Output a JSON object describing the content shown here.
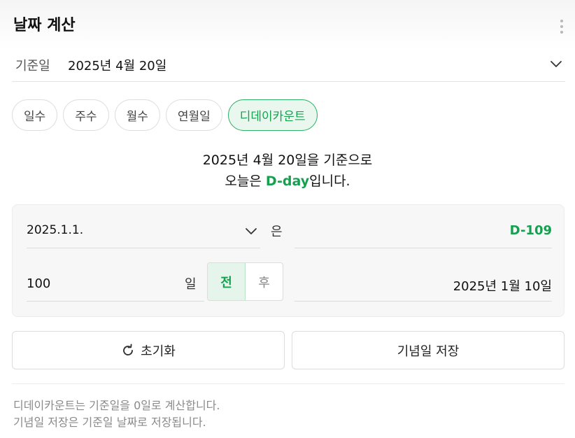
{
  "header": {
    "title": "날짜 계산",
    "more_icon": "more-vertical-icon"
  },
  "base_date": {
    "label": "기준일",
    "value": "2025년 4월 20일"
  },
  "tabs": [
    {
      "label": "일수",
      "active": false
    },
    {
      "label": "주수",
      "active": false
    },
    {
      "label": "월수",
      "active": false
    },
    {
      "label": "연월일",
      "active": false
    },
    {
      "label": "디데이카운트",
      "active": true
    }
  ],
  "result": {
    "line1": "2025년 4월 20일을 기준으로",
    "line2_prefix": "오늘은 ",
    "line2_highlight": "D-day",
    "line2_suffix": "입니다."
  },
  "calculator": {
    "date_input": "2025.1.1.",
    "eun_label": "은",
    "dday_result": "D-109",
    "days_input": "100",
    "il_label": "일",
    "toggle": [
      {
        "label": "전",
        "active": true
      },
      {
        "label": "후",
        "active": false
      }
    ],
    "result_date": "2025년 1월 10일"
  },
  "buttons": {
    "reset_label": "초기화",
    "save_label": "기념일 저장"
  },
  "notes": [
    "디데이카운트는 기준일을 0일로 계산합니다.",
    "기념일 저장은 기준일 날짜로 저장됩니다."
  ],
  "colors": {
    "accent": "#15a04f",
    "accent_bg": "#eaf7ef",
    "muted_text": "#8a8a8a"
  }
}
